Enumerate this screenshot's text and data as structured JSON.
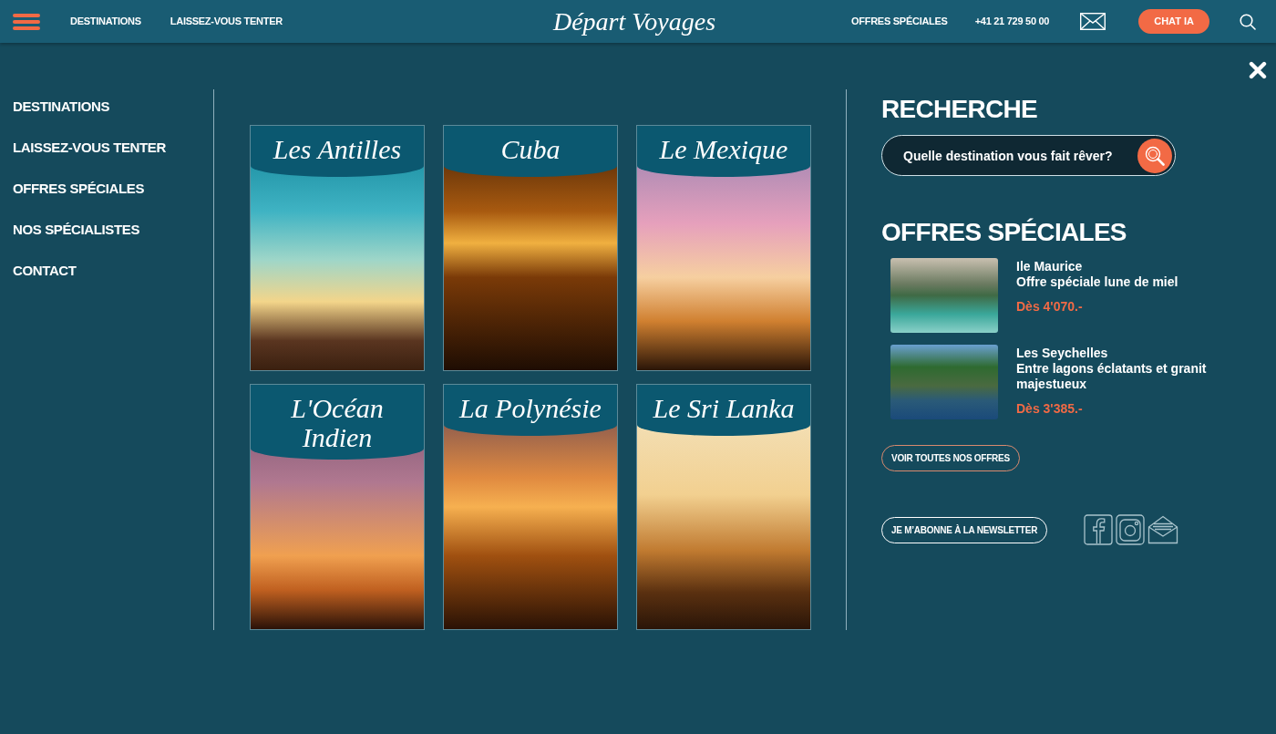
{
  "header": {
    "links": [
      "DESTINATIONS",
      "LAISSEZ-VOUS TENTER"
    ],
    "logo": "Départ Voyages",
    "right_links": [
      "OFFRES SPÉCIALES"
    ],
    "phone": "+41 21 729 50 00",
    "chat_button": "CHAT IA"
  },
  "menu": {
    "items": [
      "DESTINATIONS",
      "LAISSEZ-VOUS TENTER",
      "OFFRES SPÉCIALES",
      "NOS SPÉCIALISTES",
      "CONTACT"
    ]
  },
  "destinations": [
    {
      "title": "Les Antilles"
    },
    {
      "title": "Cuba"
    },
    {
      "title": "Le Mexique"
    },
    {
      "title": "L'Océan Indien"
    },
    {
      "title": "La Polynésie"
    },
    {
      "title": "Le Sri Lanka"
    }
  ],
  "search": {
    "heading": "RECHERCHE",
    "placeholder": "Quelle destination vous fait rêver?"
  },
  "offers": {
    "heading": "OFFRES SPÉCIALES",
    "items": [
      {
        "name": "Ile Maurice",
        "subtitle": "Offre spéciale lune de miel",
        "price": "Dès 4'070.-"
      },
      {
        "name": "Les Seychelles",
        "subtitle": "Entre lagons éclatants et granit majestueux",
        "price": "Dès 3'385.-"
      }
    ],
    "all_button": "VOIR TOUTES NOS OFFRES"
  },
  "newsletter_button": "JE M’ABONNE À LA NEWSLETTER"
}
